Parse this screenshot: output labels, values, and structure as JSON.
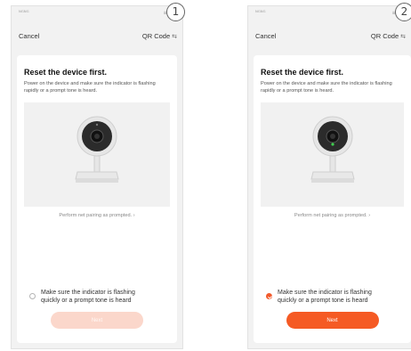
{
  "screens": [
    {
      "step": "1",
      "status_left": "ᴺᴳᴺᴳ",
      "status_right": "≡ ▮▮",
      "nav": {
        "cancel_label": "Cancel",
        "qr_label": "QR Code",
        "qr_icon": "qr-switch-icon"
      },
      "title": "Reset the device first.",
      "description": "Power on the device and make sure the indicator is flashing rapidly or a prompt tone is heard.",
      "pair_link": "Perform net pairing as prompted.",
      "confirm_text_line1": "Make sure the indicator is flashing",
      "confirm_text_line2": "quickly or a prompt tone is heard",
      "confirm_checked": false,
      "next_label": "Next",
      "next_enabled": false
    },
    {
      "step": "2",
      "status_left": "ᴺᴳᴺᴳ",
      "status_right": "≡ ▮▮",
      "nav": {
        "cancel_label": "Cancel",
        "qr_label": "QR Code",
        "qr_icon": "qr-switch-icon"
      },
      "title": "Reset the device first.",
      "description": "Power on the device and make sure the indicator is flashing rapidly or a prompt tone is heard.",
      "pair_link": "Perform net pairing as prompted.",
      "confirm_text_line1": "Make sure the indicator is flashing",
      "confirm_text_line2": "quickly or a prompt tone is heard",
      "confirm_checked": true,
      "next_label": "Next",
      "next_enabled": true
    }
  ],
  "colors": {
    "accent": "#f55a24",
    "accent_disabled": "#fbd7cb",
    "card": "#ffffff",
    "background": "#f2f2f2"
  }
}
